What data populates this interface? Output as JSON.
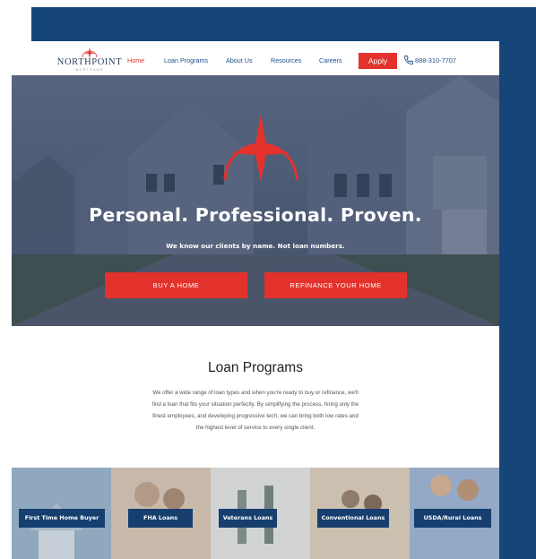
{
  "header": {
    "logo_word": "NORTHPOINT",
    "logo_sub": "MORTGAGE",
    "nav": [
      "Home",
      "Loan Programs",
      "About Us",
      "Resources",
      "Careers"
    ],
    "active_nav": "Home",
    "apply_label": "Apply",
    "phone": "888-310-7707"
  },
  "hero": {
    "title": "Personal. Professional. Proven.",
    "subtitle": "We know our clients by name. Not loan numbers.",
    "buy_label": "BUY A HOME",
    "refi_label": "REFINANCE YOUR HOME"
  },
  "programs": {
    "title": "Loan Programs",
    "body": "We offer a wide range of loan types and when you're ready to buy or refinance, we'll find a loan that fits your situation perfectly. By simplifying the process, hiring only the finest employees, and developing progressive tech, we can bring both low rates and the highest level of service to every single client.",
    "tiles": [
      "First Time Home Buyer",
      "FHA Loans",
      "Veterans Loans",
      "Conventional Loans",
      "USDA/Rural Loans"
    ]
  },
  "colors": {
    "brand_red": "#e3322b",
    "brand_navy": "#164679",
    "nav_blue": "#1c4f8c"
  }
}
